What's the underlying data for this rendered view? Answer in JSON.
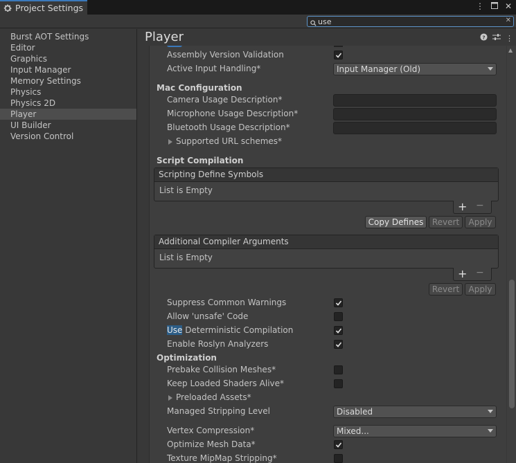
{
  "window": {
    "tab_title": "Project Settings",
    "icons": [
      "more-vertical-icon",
      "maximize-icon",
      "close-icon"
    ]
  },
  "search": {
    "value": "use"
  },
  "sidebar": {
    "items": [
      {
        "label": "Burst AOT Settings",
        "selected": false
      },
      {
        "label": "Editor",
        "selected": false
      },
      {
        "label": "Graphics",
        "selected": false
      },
      {
        "label": "Input Manager",
        "selected": false
      },
      {
        "label": "Memory Settings",
        "selected": false
      },
      {
        "label": "Physics",
        "selected": false
      },
      {
        "label": "Physics 2D",
        "selected": false
      },
      {
        "label": "Player",
        "selected": true
      },
      {
        "label": "UI Builder",
        "selected": false
      },
      {
        "label": "Version Control",
        "selected": false
      }
    ]
  },
  "main": {
    "title": "Player",
    "header_icons": [
      "help-icon",
      "preset-icon",
      "more-vertical-icon"
    ]
  },
  "settings": {
    "assembly_version_validation": {
      "label": "Assembly Version Validation",
      "checked": true
    },
    "active_input_handling": {
      "label": "Active Input Handling*",
      "value": "Input Manager (Old)"
    },
    "mac_section": "Mac Configuration",
    "camera_usage": {
      "label": "Camera Usage Description*",
      "value": ""
    },
    "microphone_usage": {
      "label": "Microphone Usage Description*",
      "value": ""
    },
    "bluetooth_usage": {
      "label": "Bluetooth Usage Description*",
      "value": ""
    },
    "url_schemes": {
      "label": "Supported URL schemes*"
    },
    "script_compilation_section": "Script Compilation",
    "scripting_define_symbols": {
      "header": "Scripting Define Symbols",
      "empty_text": "List is Empty"
    },
    "copy_defines_label": "Copy Defines",
    "revert_label": "Revert",
    "apply_label": "Apply",
    "additional_compiler_args": {
      "header": "Additional Compiler Arguments",
      "empty_text": "List is Empty"
    },
    "suppress_warnings": {
      "label": "Suppress Common Warnings",
      "checked": true
    },
    "allow_unsafe": {
      "label": "Allow 'unsafe' Code",
      "checked": false
    },
    "deterministic": {
      "label_highlight": "Use",
      "label_rest": " Deterministic Compilation",
      "checked": true
    },
    "roslyn": {
      "label": "Enable Roslyn Analyzers",
      "checked": true
    },
    "optimization_section": "Optimization",
    "prebake": {
      "label": "Prebake Collision Meshes*",
      "checked": false
    },
    "keep_shaders": {
      "label": "Keep Loaded Shaders Alive*",
      "checked": false
    },
    "preloaded_assets": {
      "label": "Preloaded Assets*"
    },
    "managed_stripping": {
      "label": "Managed Stripping Level",
      "value": "Disabled"
    },
    "vertex_compression": {
      "label": "Vertex Compression*",
      "value": "Mixed..."
    },
    "optimize_mesh": {
      "label": "Optimize Mesh Data*",
      "checked": true
    },
    "mipmap_stripping": {
      "label": "Texture MipMap Stripping*",
      "checked": false
    }
  },
  "colors": {
    "accent": "#3a79bb",
    "highlight": "#2c5d87",
    "background": "#383838"
  }
}
